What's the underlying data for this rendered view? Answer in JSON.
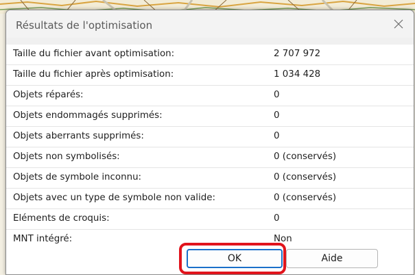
{
  "dialog": {
    "title": "Résultats de l'optimisation",
    "close_icon": "close-icon",
    "rows": [
      {
        "label": "Taille du fichier avant optimisation:",
        "value": "2 707 972"
      },
      {
        "label": "Taille du fichier après optimisation:",
        "value": "1 034 428"
      },
      {
        "label": "Objets réparés:",
        "value": "0"
      },
      {
        "label": "Objets endommagés supprimés:",
        "value": "0"
      },
      {
        "label": "Objets aberrants supprimés:",
        "value": "0"
      },
      {
        "label": "Objets non symbolisés:",
        "value": "0 (conservés)"
      },
      {
        "label": "Objets de symbole inconnu:",
        "value": "0 (conservés)"
      },
      {
        "label": "Objets avec un type de symbole non valide:",
        "value": "0 (conservés)"
      },
      {
        "label": "Eléments de croquis:",
        "value": "0"
      },
      {
        "label": "MNT intégré:",
        "value": "Non"
      }
    ],
    "buttons": {
      "ok_label": "OK",
      "help_label": "Aide"
    }
  },
  "colors": {
    "highlight": "#e1141c",
    "focus_border": "#1a6fc9"
  }
}
